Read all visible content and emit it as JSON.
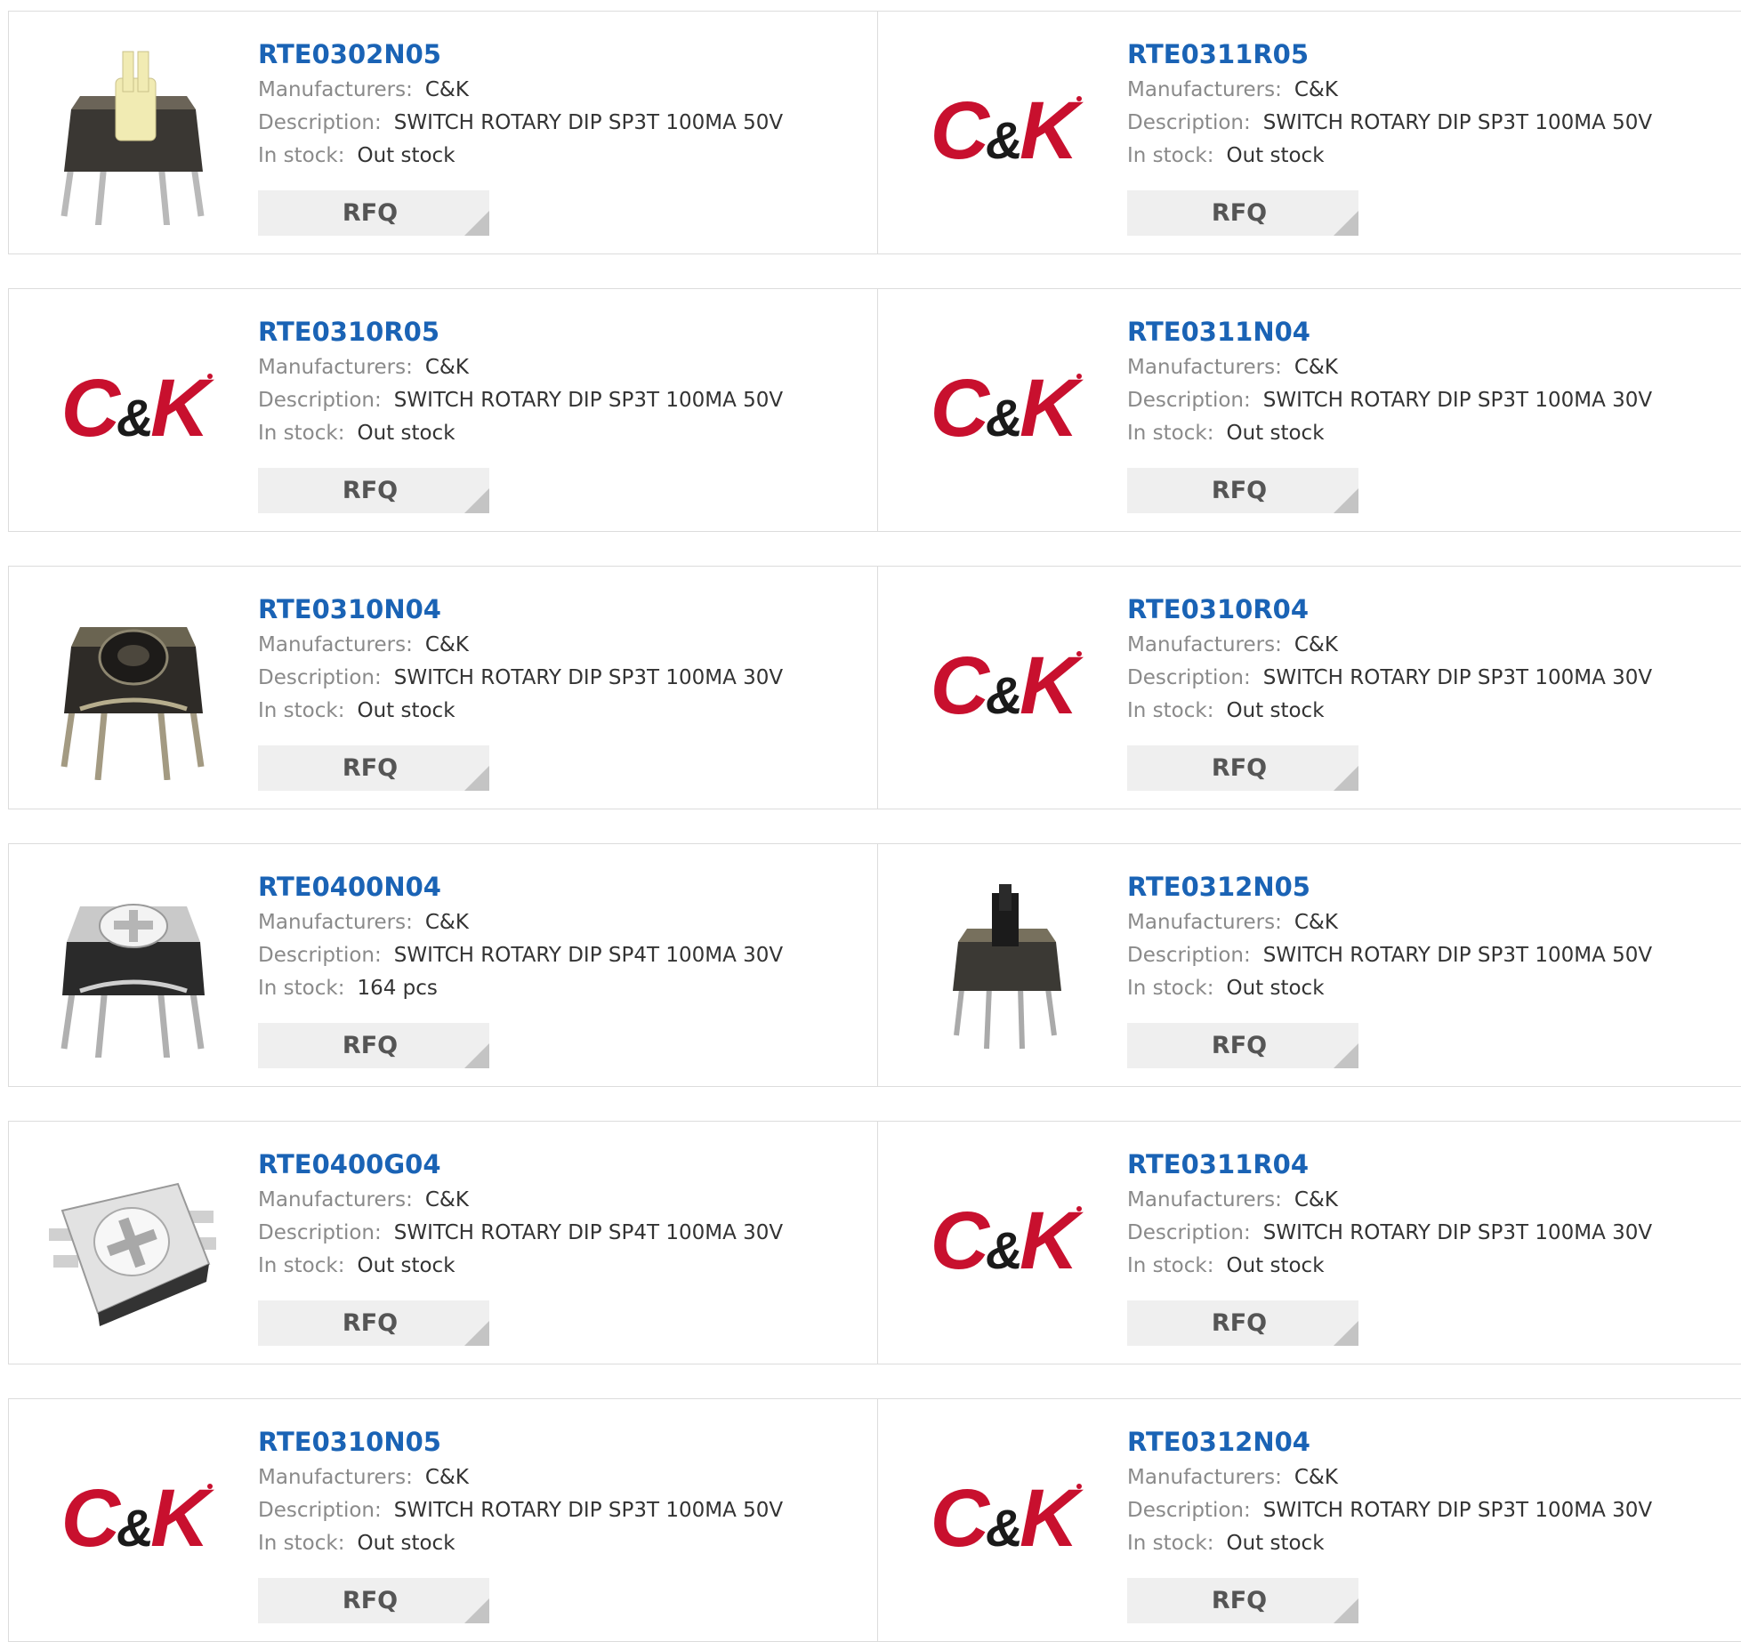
{
  "labels": {
    "manufacturer": "Manufacturers:",
    "description": "Description:",
    "stock": "In stock:",
    "rfq": "RFQ"
  },
  "colors": {
    "link": "#1a63b5",
    "logo_red": "#c8102e"
  },
  "products": [
    {
      "part_number": "RTE0302N05",
      "manufacturer": "C&K",
      "description": "SWITCH ROTARY DIP SP3T 100MA 50V",
      "stock": "Out stock",
      "image": "rotary-switch-yellow-shaft-photo"
    },
    {
      "part_number": "RTE0311R05",
      "manufacturer": "C&K",
      "description": "SWITCH ROTARY DIP SP3T 100MA 50V",
      "stock": "Out stock",
      "image": "ck-logo"
    },
    {
      "part_number": "RTE0310R05",
      "manufacturer": "C&K",
      "description": "SWITCH ROTARY DIP SP3T 100MA 50V",
      "stock": "Out stock",
      "image": "ck-logo"
    },
    {
      "part_number": "RTE0311N04",
      "manufacturer": "C&K",
      "description": "SWITCH ROTARY DIP SP3T 100MA 30V",
      "stock": "Out stock",
      "image": "ck-logo"
    },
    {
      "part_number": "RTE0310N04",
      "manufacturer": "C&K",
      "description": "SWITCH ROTARY DIP SP3T 100MA 30V",
      "stock": "Out stock",
      "image": "rotary-switch-dark-photo"
    },
    {
      "part_number": "RTE0310R04",
      "manufacturer": "C&K",
      "description": "SWITCH ROTARY DIP SP3T 100MA 30V",
      "stock": "Out stock",
      "image": "ck-logo"
    },
    {
      "part_number": "RTE0400N04",
      "manufacturer": "C&K",
      "description": "SWITCH ROTARY DIP SP4T 100MA 30V",
      "stock": "164 pcs",
      "image": "rotary-switch-white-cross-photo"
    },
    {
      "part_number": "RTE0312N05",
      "manufacturer": "C&K",
      "description": "SWITCH ROTARY DIP SP3T 100MA 50V",
      "stock": "Out stock",
      "image": "rotary-switch-black-shaft-photo"
    },
    {
      "part_number": "RTE0400G04",
      "manufacturer": "C&K",
      "description": "SWITCH ROTARY DIP SP4T 100MA 30V",
      "stock": "Out stock",
      "image": "rotary-switch-smd-photo"
    },
    {
      "part_number": "RTE0311R04",
      "manufacturer": "C&K",
      "description": "SWITCH ROTARY DIP SP3T 100MA 30V",
      "stock": "Out stock",
      "image": "ck-logo"
    },
    {
      "part_number": "RTE0310N05",
      "manufacturer": "C&K",
      "description": "SWITCH ROTARY DIP SP3T 100MA 50V",
      "stock": "Out stock",
      "image": "ck-logo"
    },
    {
      "part_number": "RTE0312N04",
      "manufacturer": "C&K",
      "description": "SWITCH ROTARY DIP SP3T 100MA 30V",
      "stock": "Out stock",
      "image": "ck-logo"
    }
  ]
}
